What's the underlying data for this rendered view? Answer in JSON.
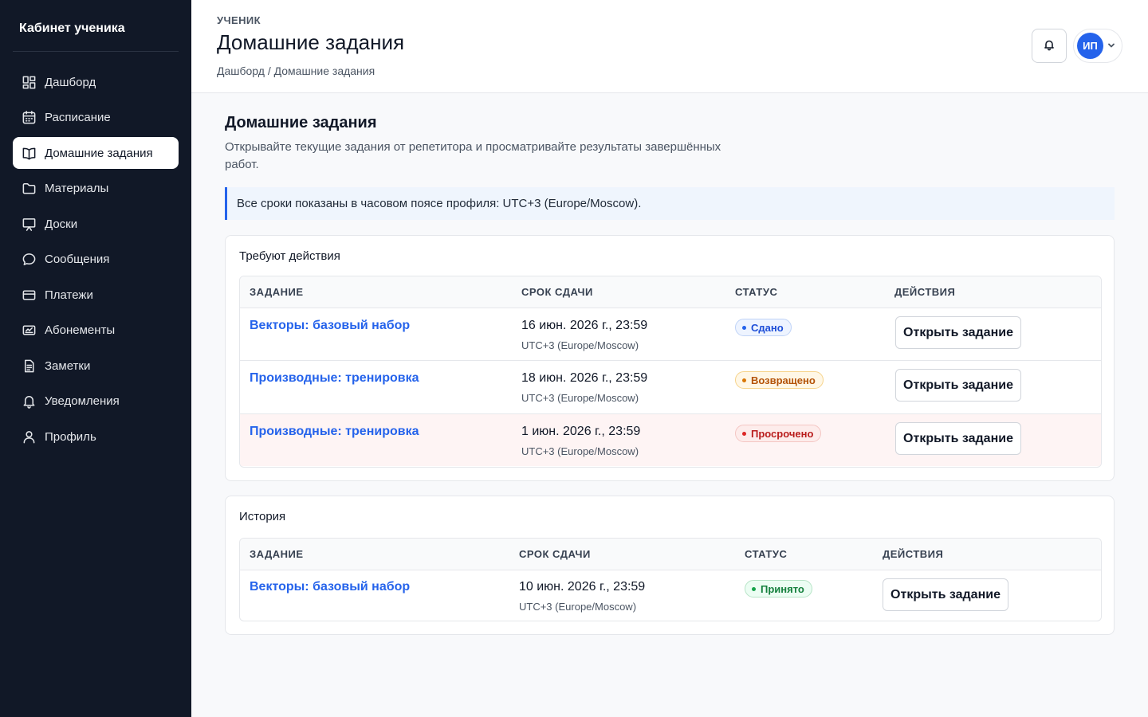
{
  "sidebar": {
    "brand": "Кабинет ученика",
    "items": [
      {
        "label": "Дашборд",
        "icon": "dashboard-icon"
      },
      {
        "label": "Расписание",
        "icon": "calendar-icon"
      },
      {
        "label": "Домашние задания",
        "icon": "book-icon",
        "active": true
      },
      {
        "label": "Материалы",
        "icon": "folder-icon"
      },
      {
        "label": "Доски",
        "icon": "whiteboard-icon"
      },
      {
        "label": "Сообщения",
        "icon": "message-icon"
      },
      {
        "label": "Платежи",
        "icon": "card-icon"
      },
      {
        "label": "Абонементы",
        "icon": "ticket-icon"
      },
      {
        "label": "Заметки",
        "icon": "note-icon"
      },
      {
        "label": "Уведомления",
        "icon": "bell-icon"
      },
      {
        "label": "Профиль",
        "icon": "user-icon"
      }
    ]
  },
  "header": {
    "eyebrow": "УЧЕНИК",
    "title": "Домашние задания",
    "breadcrumb": "Дашборд / Домашние задания",
    "avatar_initials": "ИП"
  },
  "main": {
    "title": "Домашние задания",
    "description": "Открывайте текущие задания от репетитора и просматривайте результаты завершённых работ.",
    "info": "Все сроки показаны в часовом поясе профиля: UTC+3 (Europe/Moscow)."
  },
  "action_section": {
    "title": "Требуют действия",
    "columns": [
      "ЗАДАНИЕ",
      "СРОК СДАЧИ",
      "СТАТУС",
      "ДЕЙСТВИЯ"
    ],
    "rows": [
      {
        "task": "Векторы: базовый набор",
        "due": "16 июн. 2026 г., 23:59",
        "tz": "UTC+3 (Europe/Moscow)",
        "status": "Сдано",
        "action": "Открыть задание"
      },
      {
        "task": "Производные: тренировка",
        "due": "18 июн. 2026 г., 23:59",
        "tz": "UTC+3 (Europe/Moscow)",
        "status": "Возвращено",
        "action": "Открыть задание"
      },
      {
        "task": "Производные: тренировка",
        "due": "1 июн. 2026 г., 23:59",
        "tz": "UTC+3 (Europe/Moscow)",
        "status": "Просрочено",
        "action": "Открыть задание"
      }
    ]
  },
  "history_section": {
    "title": "История",
    "columns": [
      "ЗАДАНИЕ",
      "СРОК СДАЧИ",
      "СТАТУС",
      "ДЕЙСТВИЯ"
    ],
    "rows": [
      {
        "task": "Векторы: базовый набор",
        "due": "10 июн. 2026 г., 23:59",
        "tz": "UTC+3 (Europe/Moscow)",
        "status": "Принято",
        "action": "Открыть задание"
      }
    ]
  },
  "colors": {
    "sidebar_bg": "#111827",
    "accent": "#2563eb",
    "status_done": "#2563eb",
    "status_returned": "#d97706",
    "status_overdue": "#dc2626",
    "status_accepted": "#16a34a"
  }
}
